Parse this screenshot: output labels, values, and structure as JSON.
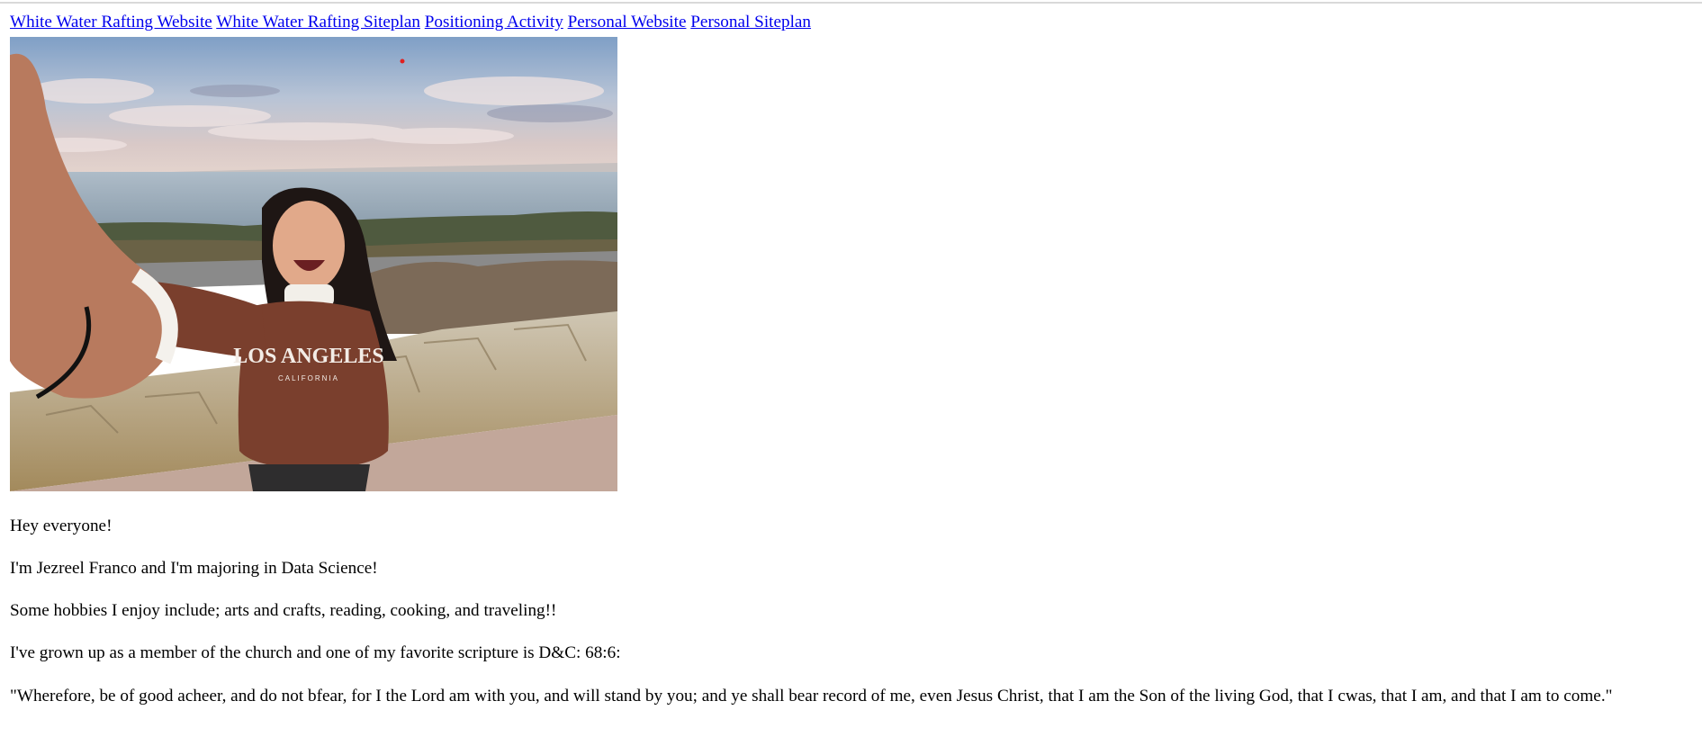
{
  "nav": {
    "links": [
      "White Water Rafting Website",
      "White Water Rafting Siteplan",
      "Positioning Activity",
      "Personal Website",
      "Personal Siteplan"
    ]
  },
  "photo": {
    "sweatshirt_text": "LOS ANGELES",
    "sweatshirt_subtext": "CALIFORNIA"
  },
  "content": {
    "greeting": "Hey everyone!",
    "intro": "I'm Jezreel Franco and I'm majoring in Data Science!",
    "hobbies": "Some hobbies I enjoy include; arts and crafts, reading, cooking, and traveling!!",
    "scripture_intro": "I've grown up as a member of the church and one of my favorite scripture is D&C: 68:6:",
    "scripture_quote": "\"Wherefore, be of good acheer, and do not bfear, for I the Lord am with you, and will stand by you; and ye shall bear record of me, even Jesus Christ, that I am the Son of the living God, that I cwas, that I am, and that I am to come.\""
  },
  "colors": {
    "link": "#0000ee",
    "text": "#000000",
    "background": "#ffffff"
  }
}
